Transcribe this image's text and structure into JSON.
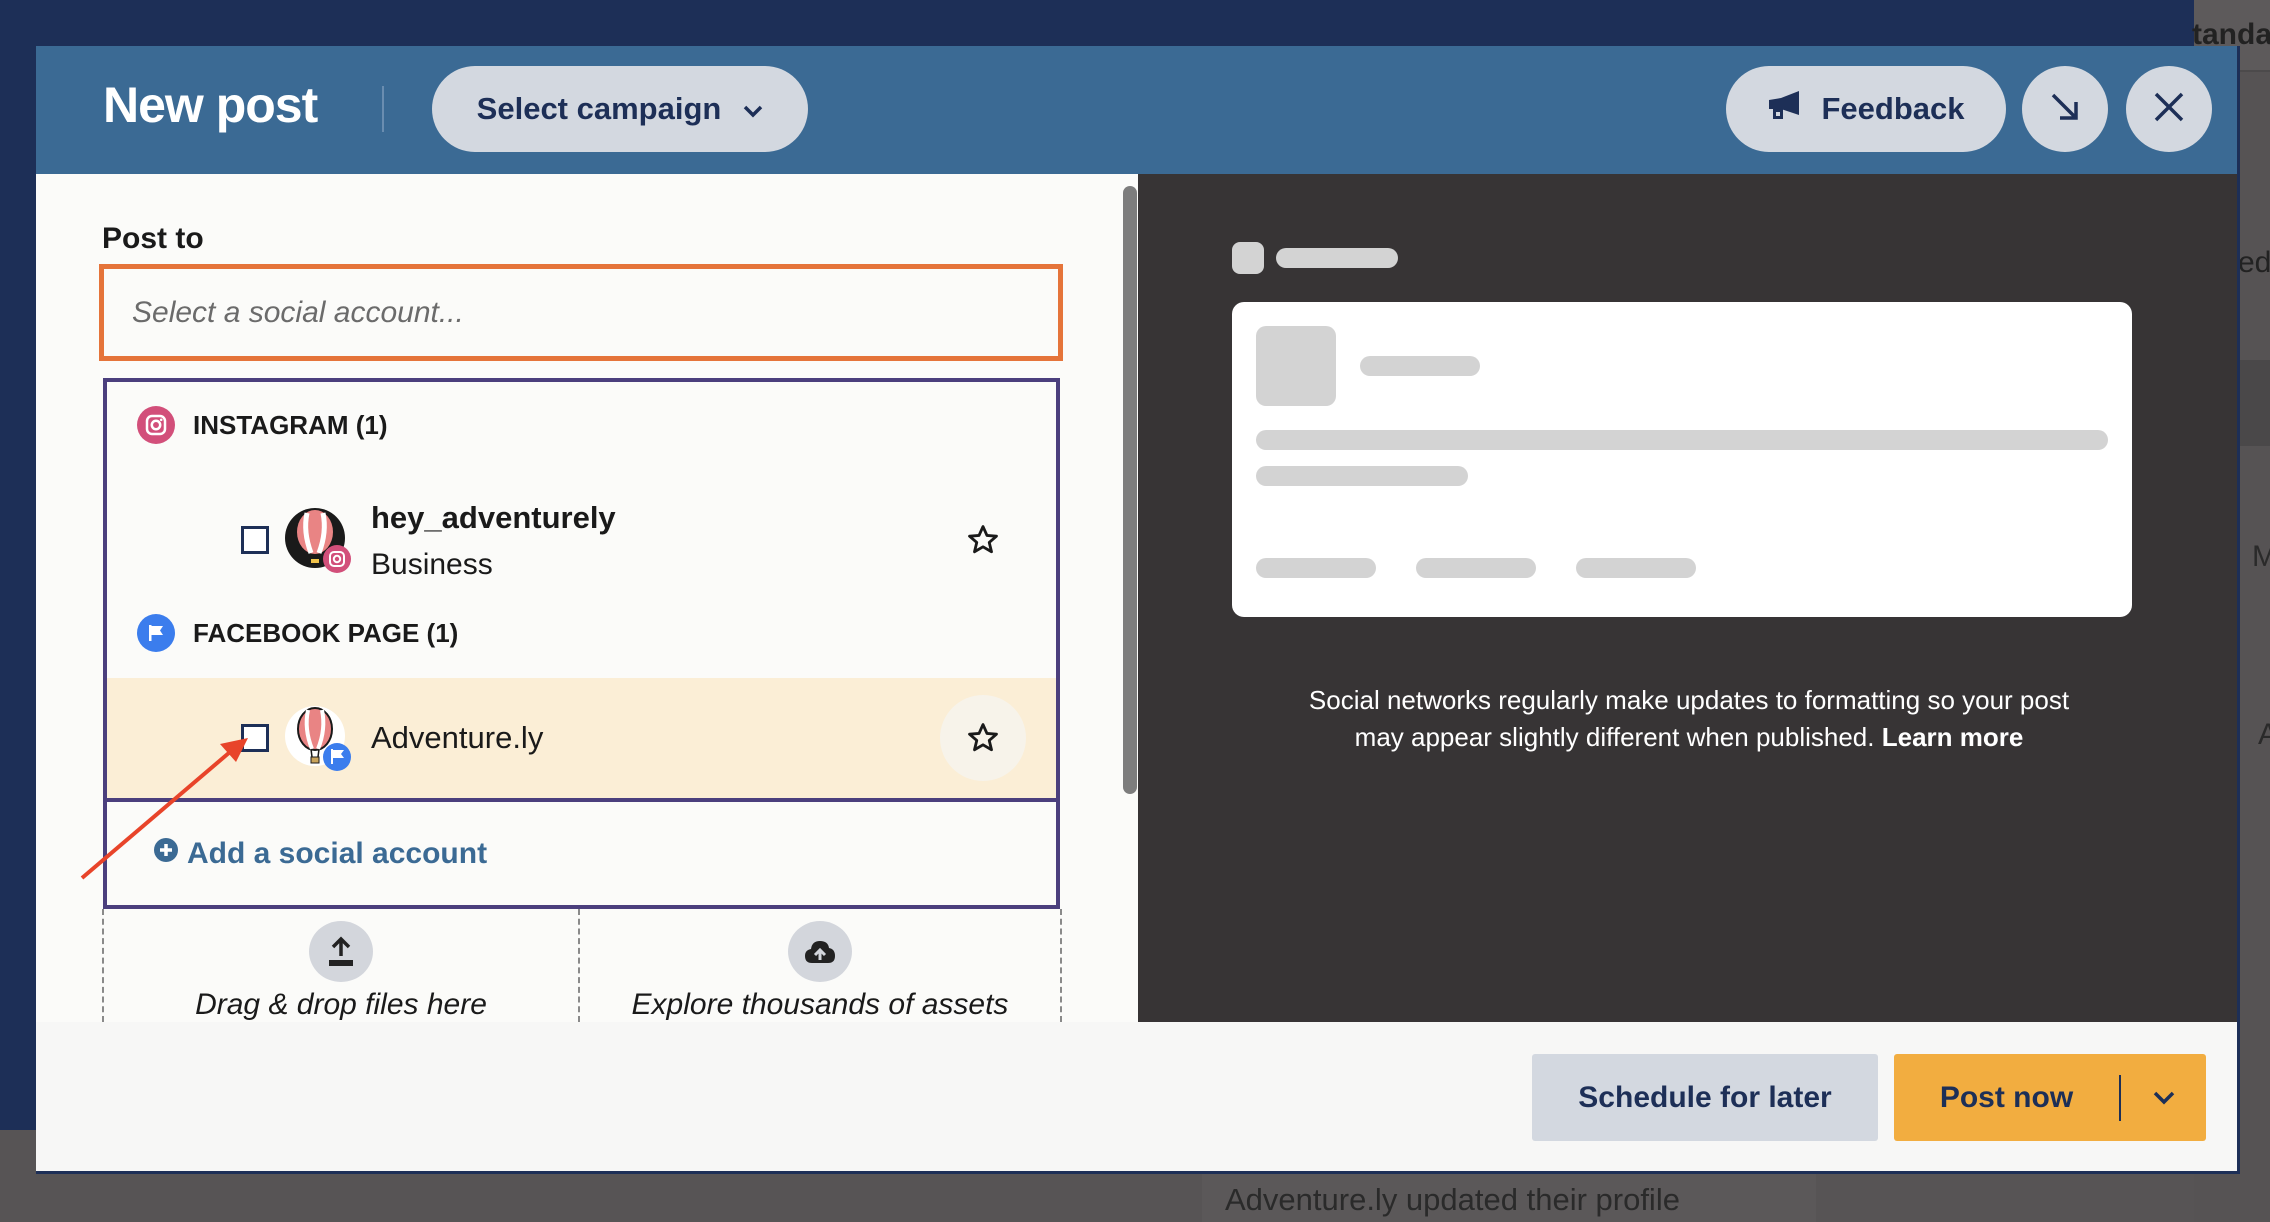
{
  "background": {
    "top_right_text": "tanda",
    "right_text_1": "ed",
    "right_text_2": "M",
    "right_text_3": "A",
    "bottom_activity": "Adventure.ly updated their profile"
  },
  "header": {
    "title": "New post",
    "campaign_select_label": "Select campaign",
    "feedback_label": "Feedback",
    "minimize_icon": "arrow-down-right-icon",
    "close_icon": "close-icon"
  },
  "composer": {
    "post_to_label": "Post to",
    "account_input": {
      "value": "",
      "placeholder": "Select a social account..."
    },
    "account_groups": [
      {
        "network": "Instagram",
        "label": "INSTAGRAM (1)",
        "icon": "instagram-icon",
        "color": "#d24f7a",
        "accounts": [
          {
            "name": "hey_adventurely",
            "subtitle": "Business",
            "checked": false,
            "favorite": false,
            "highlighted": false
          }
        ]
      },
      {
        "network": "Facebook Page",
        "label": "FACEBOOK PAGE (1)",
        "icon": "facebook-page-flag-icon",
        "color": "#3b7ded",
        "accounts": [
          {
            "name": "Adventure.ly",
            "subtitle": "",
            "checked": false,
            "favorite": false,
            "highlighted": true
          }
        ]
      }
    ],
    "add_account_label": "Add a social account",
    "media": {
      "upload_label": "Drag & drop files here",
      "explore_label": "Explore thousands of assets"
    }
  },
  "preview": {
    "caption": "Social networks regularly make updates to formatting so your post may appear slightly different when published.",
    "learn_more_label": "Learn more"
  },
  "footer": {
    "schedule_label": "Schedule for later",
    "post_now_label": "Post now"
  },
  "colors": {
    "header_bg": "#3b6a94",
    "accent_navy": "#1d2f57",
    "input_focus_border": "#e5743a",
    "dropdown_border": "#4b3f7d",
    "row_highlight": "#fbeed6",
    "post_now_bg": "#f2ad40",
    "annotation_arrow": "#e8442a"
  }
}
